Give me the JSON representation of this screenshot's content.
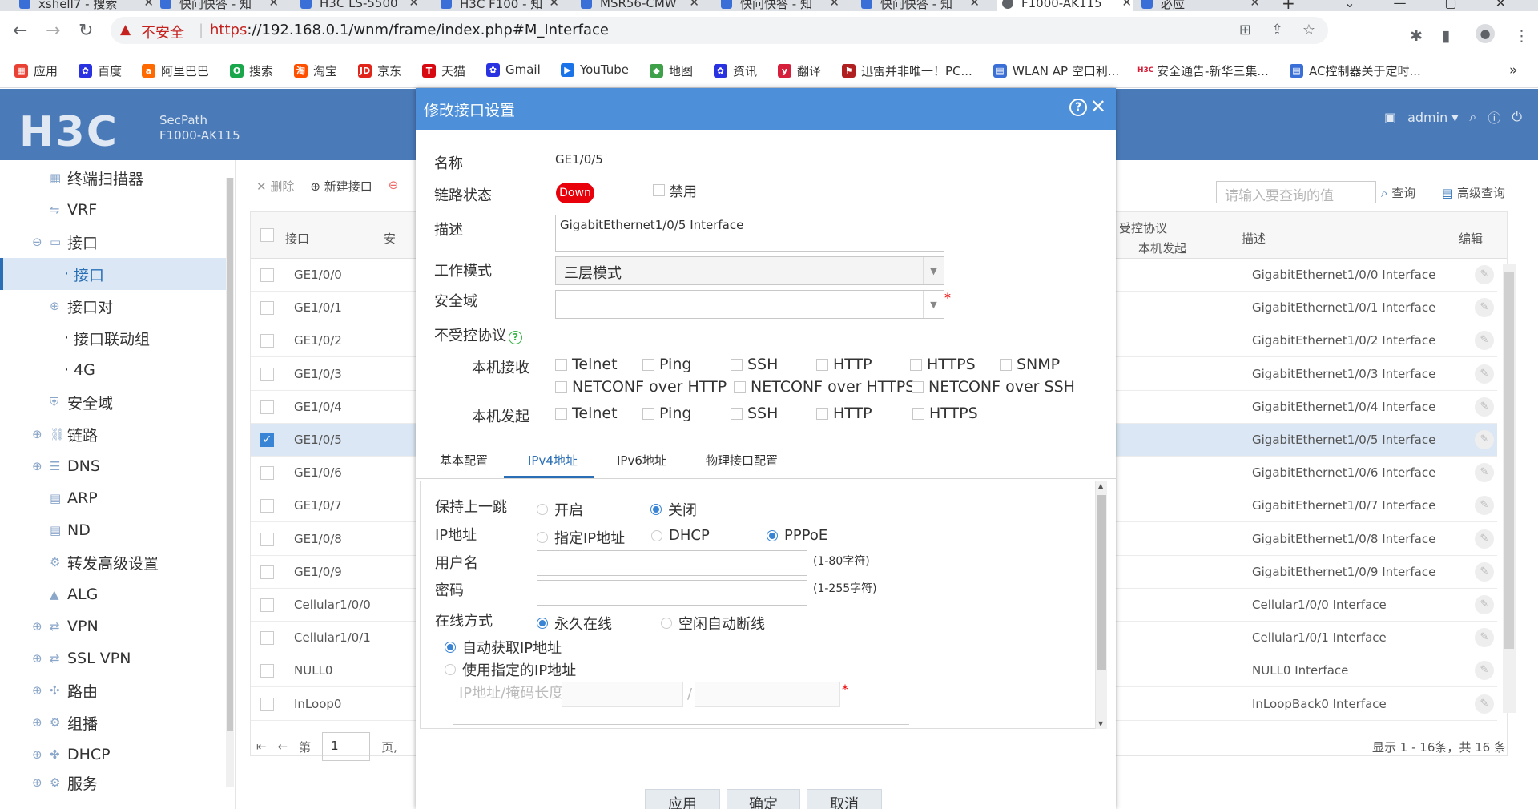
{
  "browser": {
    "tabs": [
      {
        "title": "xshell7 - 搜索",
        "icon_color": "#3b6fd8"
      },
      {
        "title": "快问快答 - 知",
        "icon_color": "#3b6fd8"
      },
      {
        "title": "H3C LS-5500",
        "icon_color": "#3b6fd8"
      },
      {
        "title": "H3C F100 - 知",
        "icon_color": "#3b6fd8"
      },
      {
        "title": "MSR56-CMW",
        "icon_color": "#3b6fd8"
      },
      {
        "title": "快问快答 - 知",
        "icon_color": "#3b6fd8"
      },
      {
        "title": "快问快答 - 知",
        "icon_color": "#3b6fd8"
      },
      {
        "title": "F1000-AK115",
        "icon_color": "#5f6368"
      },
      {
        "title": "必应",
        "icon_color": "#3b6fd8"
      }
    ],
    "new_tab": "+",
    "insecure_label": "不安全",
    "url_scheme": "https",
    "url_rest": "://192.168.0.1/wnm/frame/index.php#M_Interface",
    "bookmarks": [
      {
        "label": "应用",
        "icon": "apps-grid-icon",
        "color": "#e94235"
      },
      {
        "label": "百度",
        "icon": "baidu-paw-icon",
        "color": "#2932e1"
      },
      {
        "label": "阿里巴巴",
        "icon": "alibaba-icon",
        "color": "#ff6a00"
      },
      {
        "label": "搜索",
        "icon": "search-360-icon",
        "color": "#1aa64a"
      },
      {
        "label": "淘宝",
        "icon": "taobao-icon",
        "color": "#ff5000"
      },
      {
        "label": "京东",
        "icon": "jd-icon",
        "color": "#e1251b"
      },
      {
        "label": "天猫",
        "icon": "tmall-icon",
        "color": "#d70a12"
      },
      {
        "label": "Gmail",
        "icon": "baidu-paw-icon",
        "color": "#2932e1"
      },
      {
        "label": "YouTube",
        "icon": "youtube-icon",
        "color": "#1a73e8"
      },
      {
        "label": "地图",
        "icon": "map-icon",
        "color": "#3ea14a"
      },
      {
        "label": "资讯",
        "icon": "baidu-paw-icon",
        "color": "#2932e1"
      },
      {
        "label": "翻译",
        "icon": "translate-icon",
        "color": "#d6203b"
      },
      {
        "label": "迅雷并非唯一！PC...",
        "icon": "flag-icon",
        "color": "#b02020"
      },
      {
        "label": "WLAN AP 空口利...",
        "icon": "doc-icon",
        "color": "#3b6fd8"
      },
      {
        "label": "安全通告-新华三集...",
        "icon": "h3c-icon",
        "color": "#d6203b"
      },
      {
        "label": "AC控制器关于定时...",
        "icon": "doc-icon",
        "color": "#3b6fd8"
      }
    ],
    "more_bookmarks": "»"
  },
  "header": {
    "logo": "H3C",
    "product_line1": "SecPath",
    "product_line2": "F1000-AK115",
    "user": "admin"
  },
  "sidebar": {
    "items": [
      {
        "label": "终端扫描器",
        "icon": "scanner-icon",
        "indent": 1
      },
      {
        "label": "VRF",
        "icon": "vrf-icon",
        "indent": 1
      },
      {
        "label": "接口",
        "icon": "interface-icon",
        "indent": 0,
        "expanded": true
      },
      {
        "label": "接口",
        "icon": "",
        "indent": 2,
        "selected": true
      },
      {
        "label": "接口对",
        "icon": "",
        "indent": 1,
        "collapsed": true
      },
      {
        "label": "接口联动组",
        "icon": "",
        "indent": 2
      },
      {
        "label": "4G",
        "icon": "",
        "indent": 2
      },
      {
        "label": "安全域",
        "icon": "shield-icon",
        "indent": 1
      },
      {
        "label": "链路",
        "icon": "link-icon",
        "indent": 0,
        "collapsed": true
      },
      {
        "label": "DNS",
        "icon": "dns-icon",
        "indent": 0,
        "collapsed": true
      },
      {
        "label": "ARP",
        "icon": "arp-icon",
        "indent": 1
      },
      {
        "label": "ND",
        "icon": "nd-icon",
        "indent": 1
      },
      {
        "label": "转发高级设置",
        "icon": "forward-icon",
        "indent": 1
      },
      {
        "label": "ALG",
        "icon": "alg-icon",
        "indent": 1
      },
      {
        "label": "VPN",
        "icon": "vpn-icon",
        "indent": 0,
        "collapsed": true
      },
      {
        "label": "SSL VPN",
        "icon": "sslvpn-icon",
        "indent": 0,
        "collapsed": true
      },
      {
        "label": "路由",
        "icon": "route-icon",
        "indent": 0,
        "collapsed": true
      },
      {
        "label": "组播",
        "icon": "multicast-icon",
        "indent": 0,
        "collapsed": true
      },
      {
        "label": "DHCP",
        "icon": "dhcp-icon",
        "indent": 0,
        "collapsed": true
      },
      {
        "label": "服务",
        "icon": "service-icon",
        "indent": 0,
        "collapsed": true
      }
    ]
  },
  "list": {
    "toolbar": {
      "delete": "删除",
      "new": "新建接口"
    },
    "search_placeholder": "请输入要查询的值",
    "query": "查询",
    "advanced_query": "高级查询",
    "columns": {
      "interface": "接口",
      "security_short": "安",
      "unctrl": "受控协议",
      "local_origin": "本机发起",
      "desc": "描述",
      "edit": "编辑"
    },
    "rows": [
      {
        "name": "GE1/0/0",
        "desc": "GigabitEthernet1/0/0 Interface",
        "checked": false
      },
      {
        "name": "GE1/0/1",
        "desc": "GigabitEthernet1/0/1 Interface",
        "checked": false
      },
      {
        "name": "GE1/0/2",
        "desc": "GigabitEthernet1/0/2 Interface",
        "checked": false
      },
      {
        "name": "GE1/0/3",
        "desc": "GigabitEthernet1/0/3 Interface",
        "checked": false
      },
      {
        "name": "GE1/0/4",
        "desc": "GigabitEthernet1/0/4 Interface",
        "checked": false
      },
      {
        "name": "GE1/0/5",
        "desc": "GigabitEthernet1/0/5 Interface",
        "checked": true
      },
      {
        "name": "GE1/0/6",
        "desc": "GigabitEthernet1/0/6 Interface",
        "checked": false
      },
      {
        "name": "GE1/0/7",
        "desc": "GigabitEthernet1/0/7 Interface",
        "checked": false
      },
      {
        "name": "GE1/0/8",
        "desc": "GigabitEthernet1/0/8 Interface",
        "checked": false
      },
      {
        "name": "GE1/0/9",
        "desc": "GigabitEthernet1/0/9 Interface",
        "checked": false
      },
      {
        "name": "Cellular1/0/0",
        "desc": "Cellular1/0/0 Interface",
        "checked": false
      },
      {
        "name": "Cellular1/0/1",
        "desc": "Cellular1/0/1 Interface",
        "checked": false
      },
      {
        "name": "NULL0",
        "desc": "NULL0 Interface",
        "checked": false
      },
      {
        "name": "InLoop0",
        "desc": "InLoopBack0 Interface",
        "checked": false
      }
    ],
    "pager": {
      "prefix": "第",
      "page": "1",
      "suffix": "页,"
    },
    "count_text": "显示 1 - 16条，共 16 条"
  },
  "dialog": {
    "title": "修改接口设置",
    "name_label": "名称",
    "name_value": "GE1/0/5",
    "link_label": "链路状态",
    "link_value": "Down",
    "disable_label": "禁用",
    "desc_label": "描述",
    "desc_value": "GigabitEthernet1/0/5 Interface",
    "mode_label": "工作模式",
    "mode_value": "三层模式",
    "zone_label": "安全域",
    "zone_value": "",
    "unctrl_label": "不受控协议",
    "local_recv_label": "本机接收",
    "local_orig_label": "本机发起",
    "recv_protocols": [
      "Telnet",
      "Ping",
      "SSH",
      "HTTP",
      "HTTPS",
      "SNMP"
    ],
    "recv_protocols_row2": [
      "NETCONF over HTTP",
      "NETCONF over HTTPS",
      "NETCONF over SSH"
    ],
    "orig_protocols": [
      "Telnet",
      "Ping",
      "SSH",
      "HTTP",
      "HTTPS"
    ],
    "tabs": [
      "基本配置",
      "IPv4地址",
      "IPv6地址",
      "物理接口配置"
    ],
    "active_tab": "IPv4地址",
    "ipv4": {
      "hold_hop_label": "保持上一跳",
      "hold_on": "开启",
      "hold_off": "关闭",
      "hold_selected": "关闭",
      "ip_label": "IP地址",
      "ip_options": [
        "指定IP地址",
        "DHCP",
        "PPPoE"
      ],
      "ip_selected": "PPPoE",
      "user_label": "用户名",
      "user_value": "",
      "user_hint": "(1-80字符)",
      "pwd_label": "密码",
      "pwd_value": "",
      "pwd_hint": "(1-255字符)",
      "online_label": "在线方式",
      "online_always": "永久在线",
      "online_idle": "空闲自动断线",
      "online_selected": "永久在线",
      "auto_ip": "自动获取IP地址",
      "manual_ip": "使用指定的IP地址",
      "addr_selected": "自动获取IP地址",
      "ip_mask_label": "IP地址/掩码长度",
      "slash": "/"
    },
    "buttons": {
      "apply": "应用",
      "ok": "确定",
      "cancel": "取消"
    },
    "required_mark": "*"
  }
}
